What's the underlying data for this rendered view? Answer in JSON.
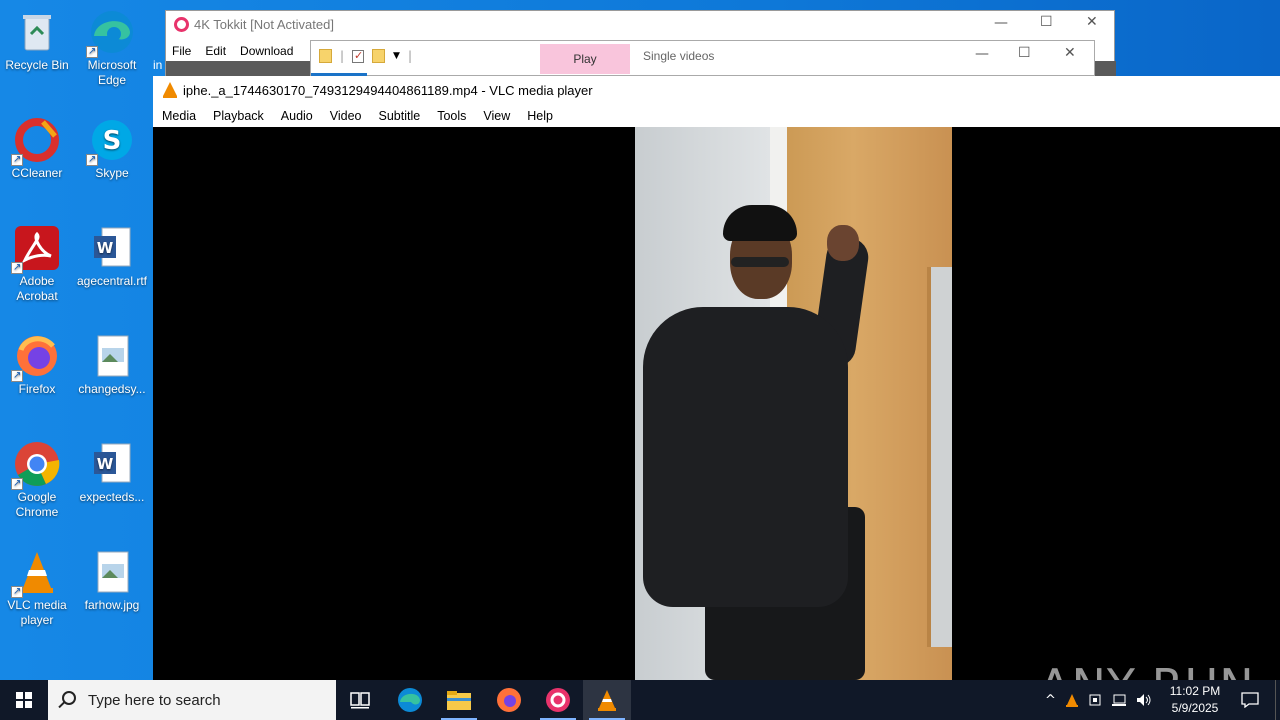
{
  "desktop": {
    "icons": [
      {
        "label": "Recycle Bin",
        "icon": "recycle-bin-icon"
      },
      {
        "label": "Microsoft Edge",
        "icon": "edge-icon"
      },
      {
        "label": "CCleaner",
        "icon": "ccleaner-icon"
      },
      {
        "label": "Skype",
        "icon": "skype-icon"
      },
      {
        "label": "Adobe Acrobat",
        "icon": "acrobat-icon"
      },
      {
        "label": "agecentral.rtf",
        "icon": "word-doc-icon"
      },
      {
        "label": "Firefox",
        "icon": "firefox-icon"
      },
      {
        "label": "changedsy...",
        "icon": "image-file-icon"
      },
      {
        "label": "Google Chrome",
        "icon": "chrome-icon"
      },
      {
        "label": "expecteds...",
        "icon": "word-doc-icon"
      },
      {
        "label": "VLC media player",
        "icon": "vlc-icon"
      },
      {
        "label": "farhow.jpg",
        "icon": "image-file-icon"
      }
    ],
    "partial_label": "in"
  },
  "tokkit": {
    "title": "4K Tokkit [Not Activated]",
    "menu": [
      "File",
      "Edit",
      "Download"
    ]
  },
  "explorer": {
    "play_tab": "Play",
    "single_tab": "Single videos"
  },
  "vlc": {
    "title": "iphe._a_1744630170_7493129494404861189.mp4 - VLC media player",
    "menu": [
      "Media",
      "Playback",
      "Audio",
      "Video",
      "Subtitle",
      "Tools",
      "View",
      "Help"
    ]
  },
  "watermark": "ANY RUN",
  "taskbar": {
    "search_placeholder": "Type here to search",
    "time": "11:02 PM",
    "date": "5/9/2025"
  },
  "colors": {
    "desktop": "#1688e6",
    "taskbar": "#101828",
    "tokkit_accent": "#e8336b",
    "play_tab": "#f9c5dc",
    "vlc_orange": "#f08a00"
  }
}
